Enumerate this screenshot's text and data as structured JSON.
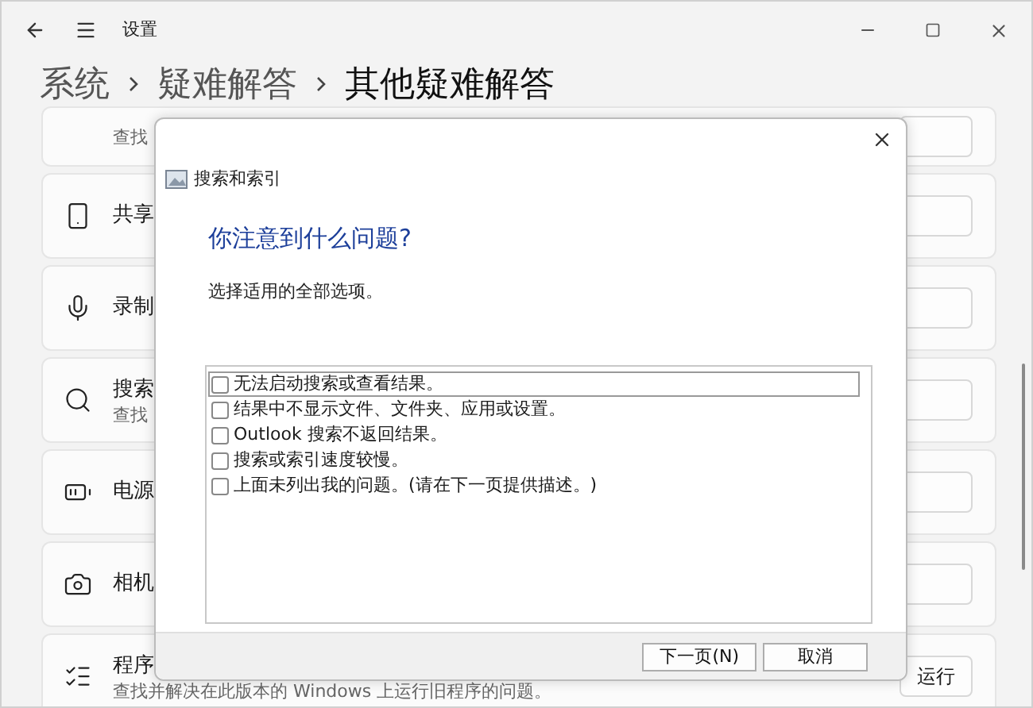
{
  "window": {
    "title": "设置"
  },
  "breadcrumb": [
    "系统",
    "疑难解答",
    "其他疑难解答"
  ],
  "cards": [
    {
      "kind": "unknown",
      "subtitle": "查找"
    },
    {
      "kind": "share",
      "title": "共享"
    },
    {
      "kind": "mic",
      "title": "录制"
    },
    {
      "kind": "search",
      "title": "搜索",
      "subtitle": "查找"
    },
    {
      "kind": "power",
      "title": "电源"
    },
    {
      "kind": "camera",
      "title": "相机"
    },
    {
      "kind": "list",
      "title": "程序",
      "subtitle": "查找并解决在此版本的 Windows 上运行旧程序的问题。",
      "button": "运行"
    }
  ],
  "dialog": {
    "title": "搜索和索引",
    "heading": "你注意到什么问题?",
    "instruction": "选择适用的全部选项。",
    "options": [
      {
        "label": "无法启动搜索或查看结果。",
        "checked": false,
        "selected": true
      },
      {
        "label": "结果中不显示文件、文件夹、应用或设置。",
        "checked": false,
        "selected": false
      },
      {
        "label": "Outlook 搜索不返回结果。",
        "checked": false,
        "selected": false
      },
      {
        "label": "搜索或索引速度较慢。",
        "checked": false,
        "selected": false
      },
      {
        "label": "上面未列出我的问题。(请在下一页提供描述。)",
        "checked": false,
        "selected": false
      }
    ],
    "buttons": [
      "下一页(N)",
      "取消"
    ]
  }
}
